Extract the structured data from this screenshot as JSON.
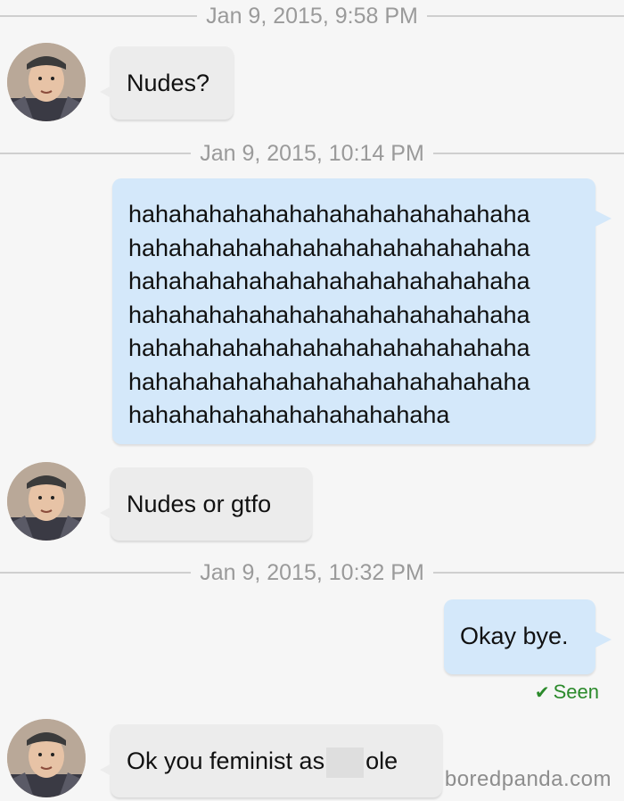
{
  "thread": {
    "timestamps": [
      "Jan 9, 2015, 9:58 PM",
      "Jan 9, 2015, 10:14 PM",
      "Jan 9, 2015, 10:32 PM"
    ],
    "messages": [
      {
        "sender": "them",
        "text": "Nudes?"
      },
      {
        "sender": "me",
        "lines": [
          "hahahahahahahahahahahahahahaha",
          "hahahahahahahahahahahahahahaha",
          "hahahahahahahahahahahahahahaha",
          "hahahahahahahahahahahahahahaha",
          "hahahahahahahahahahahahahahaha",
          "hahahahahahahahahahahahahahaha",
          "hahahahahahahahahahahaha"
        ]
      },
      {
        "sender": "them",
        "text": "Nudes or gtfo"
      },
      {
        "sender": "me",
        "text": "Okay bye."
      },
      {
        "sender": "them",
        "text_before": "Ok you feminist as",
        "text_after": "ole"
      }
    ],
    "seen_label": "Seen",
    "seen_icon": "check-icon"
  },
  "watermark": "boredpanda.com",
  "colors": {
    "incoming_bubble": "#ececec",
    "outgoing_bubble": "#d4e8fa",
    "seen": "#2b8a2b",
    "timestamp": "#9a9a9a",
    "background": "#f6f6f6"
  }
}
